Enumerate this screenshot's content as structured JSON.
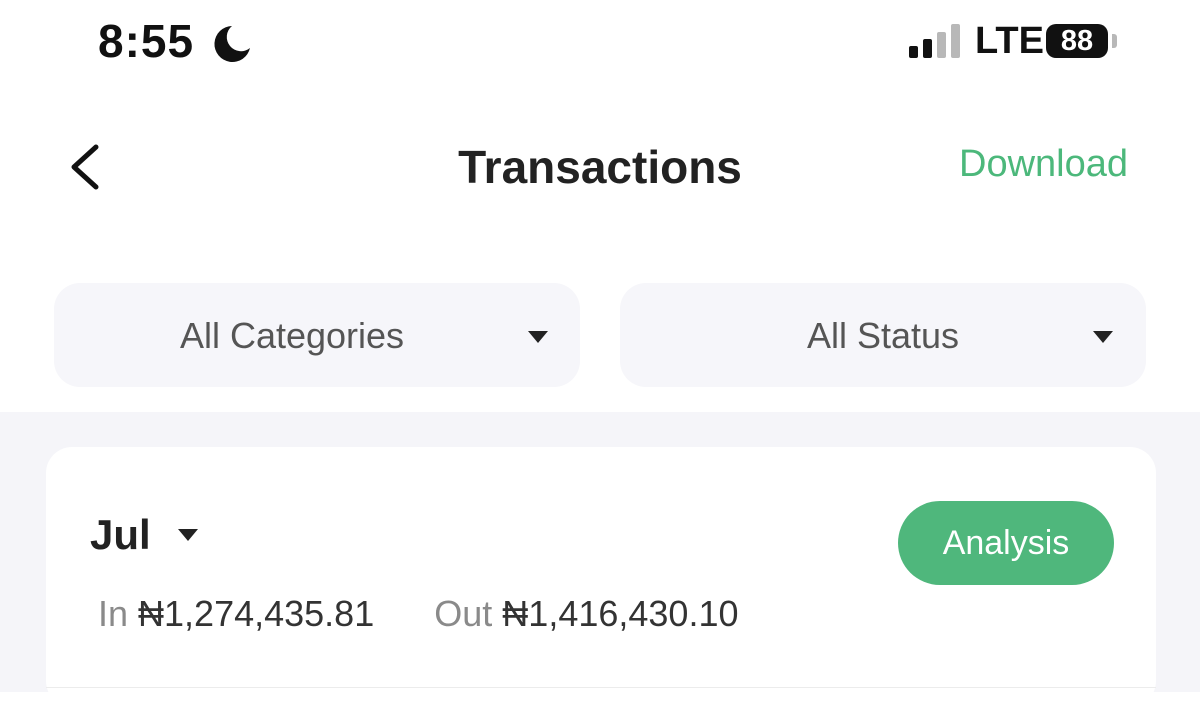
{
  "status_bar": {
    "time": "8:55",
    "network": "LTE",
    "battery": "88",
    "icons": [
      "moon-icon",
      "signal-icon",
      "battery-icon"
    ]
  },
  "header": {
    "title": "Transactions",
    "download_label": "Download",
    "icons": [
      "back-chevron-icon"
    ]
  },
  "filters": {
    "category": "All Categories",
    "status": "All Status"
  },
  "summary": {
    "month": "Jul",
    "analysis_label": "Analysis",
    "in_label": "In",
    "in_value": "₦1,274,435.81",
    "out_label": "Out",
    "out_value": "₦1,416,430.10"
  },
  "colors": {
    "accent_green": "#4fb77c",
    "text_green": "#4cb87b",
    "filter_bg": "#f6f6fa",
    "page_bg_lower": "#f5f5f9"
  }
}
